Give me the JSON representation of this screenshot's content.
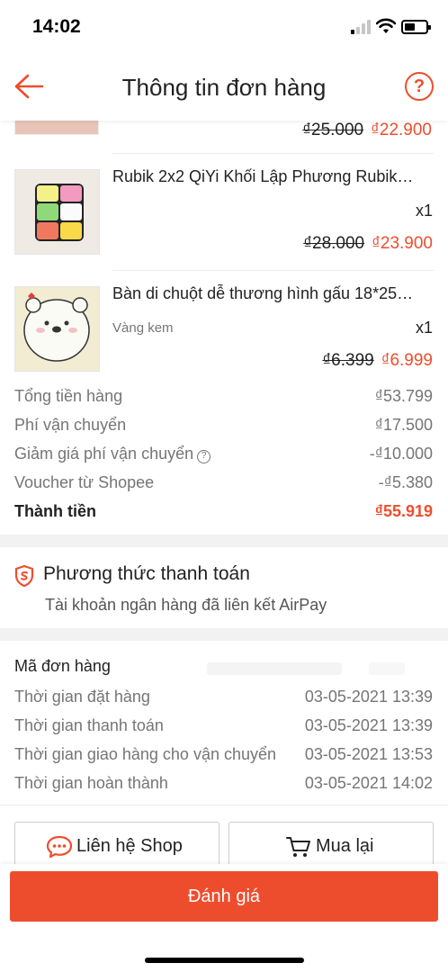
{
  "status_bar": {
    "time": "14:02"
  },
  "header": {
    "title": "Thông tin đơn hàng",
    "help_label": "?"
  },
  "previous_item": {
    "original_price": "₫25.000",
    "price": "₫22.900"
  },
  "products": [
    {
      "name": "Rubik 2x2 QiYi Khối Lập Phương Rubik…",
      "variant": "",
      "quantity": "x1",
      "original_price": "₫28.000",
      "price": "₫23.900"
    },
    {
      "name": "Bàn di chuột dễ thương hình gấu 18*25…",
      "variant": "Vàng kem",
      "quantity": "x1",
      "original_price": "₫6.399",
      "price": "₫6.999"
    }
  ],
  "summary": {
    "merchandise_label": "Tổng tiền hàng",
    "merchandise_value": "₫53.799",
    "shipping_label": "Phí vận chuyển",
    "shipping_value": "₫17.500",
    "shipping_discount_label": "Giảm giá phí vận chuyển",
    "shipping_discount_value": "-₫10.000",
    "voucher_label": "Voucher từ Shopee",
    "voucher_value": "-₫5.380",
    "total_label": "Thành tiền",
    "total_value": "₫55.919"
  },
  "payment": {
    "title": "Phương thức thanh toán",
    "method": "Tài khoản ngân hàng đã liên kết AirPay"
  },
  "order_info": {
    "code_label": "Mã đơn hàng",
    "rows": [
      {
        "label": "Thời gian đặt hàng",
        "value": "03-05-2021 13:39"
      },
      {
        "label": "Thời gian thanh toán",
        "value": "03-05-2021 13:39"
      },
      {
        "label": "Thời gian giao hàng cho vận chuyển",
        "value": "03-05-2021 13:53"
      },
      {
        "label": "Thời gian hoàn thành",
        "value": "03-05-2021 14:02"
      }
    ]
  },
  "actions": {
    "contact_shop": "Liên hệ Shop",
    "rebuy": "Mua lại",
    "rate": "Đánh giá"
  },
  "colors": {
    "accent": "#ee4d2d",
    "text": "#222222",
    "muted": "#757575",
    "divider": "#f2f2f2"
  }
}
